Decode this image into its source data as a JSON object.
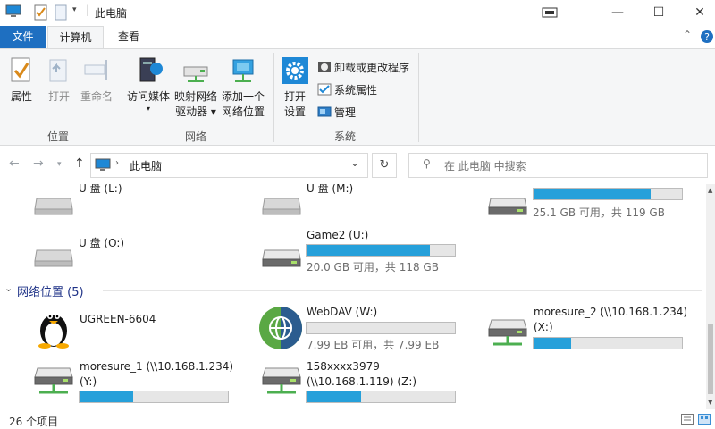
{
  "window": {
    "title": "此电脑",
    "minimize": "—",
    "maximize": "☐",
    "close": "✕"
  },
  "ribbon_tabs": {
    "file": "文件",
    "computer": "计算机",
    "view": "查看"
  },
  "ribbon": {
    "location_group": "位置",
    "network_group": "网络",
    "system_group": "系统",
    "properties": "属性",
    "open": "打开",
    "rename": "重命名",
    "access_media_1": "访问媒体",
    "map_drive_1": "映射网络",
    "map_drive_2": "驱动器 ▾",
    "add_location_1": "添加一个",
    "add_location_2": "网络位置",
    "open_settings_1": "打开",
    "open_settings_2": "设置",
    "uninstall": "卸载或更改程序",
    "system_properties": "系统属性",
    "manage": "管理"
  },
  "address": {
    "path": "此电脑",
    "search_placeholder": "在 此电脑 中搜索"
  },
  "drives_top": [
    {
      "name": "U 盘 (L:)"
    },
    {
      "name": "U 盘 (M:)"
    },
    {
      "capacity": "25.1 GB 可用，共 119 GB",
      "used_fraction": 0.79
    },
    {
      "name": "U 盘 (O:)"
    },
    {
      "name": "Game2 (U:)",
      "capacity": "20.0 GB 可用，共 118 GB",
      "used_fraction": 0.83
    }
  ],
  "network_group": {
    "title": "网络位置 (5)"
  },
  "network_items": [
    {
      "name": "UGREEN-6604"
    },
    {
      "name": "WebDAV (W:)",
      "capacity": "7.99 EB 可用，共 7.99 EB",
      "used_fraction": 0.0
    },
    {
      "name_line1": "moresure_2 (\\\\10.168.1.234)",
      "name_line2": "(X:)",
      "used_fraction": 0.25
    },
    {
      "name_line1": "moresure_1 (\\\\10.168.1.234)",
      "name_line2": "(Y:)",
      "used_fraction": 0.36
    },
    {
      "name_line1": "158xxxx3979",
      "name_line2": "(\\\\10.168.1.119) (Z:)",
      "used_fraction": 0.37
    }
  ],
  "status": {
    "item_count": "26 个项目"
  },
  "colors": {
    "accent": "#1e6fc1",
    "bar_fill": "#26a0da",
    "group_title": "#1e3287"
  }
}
